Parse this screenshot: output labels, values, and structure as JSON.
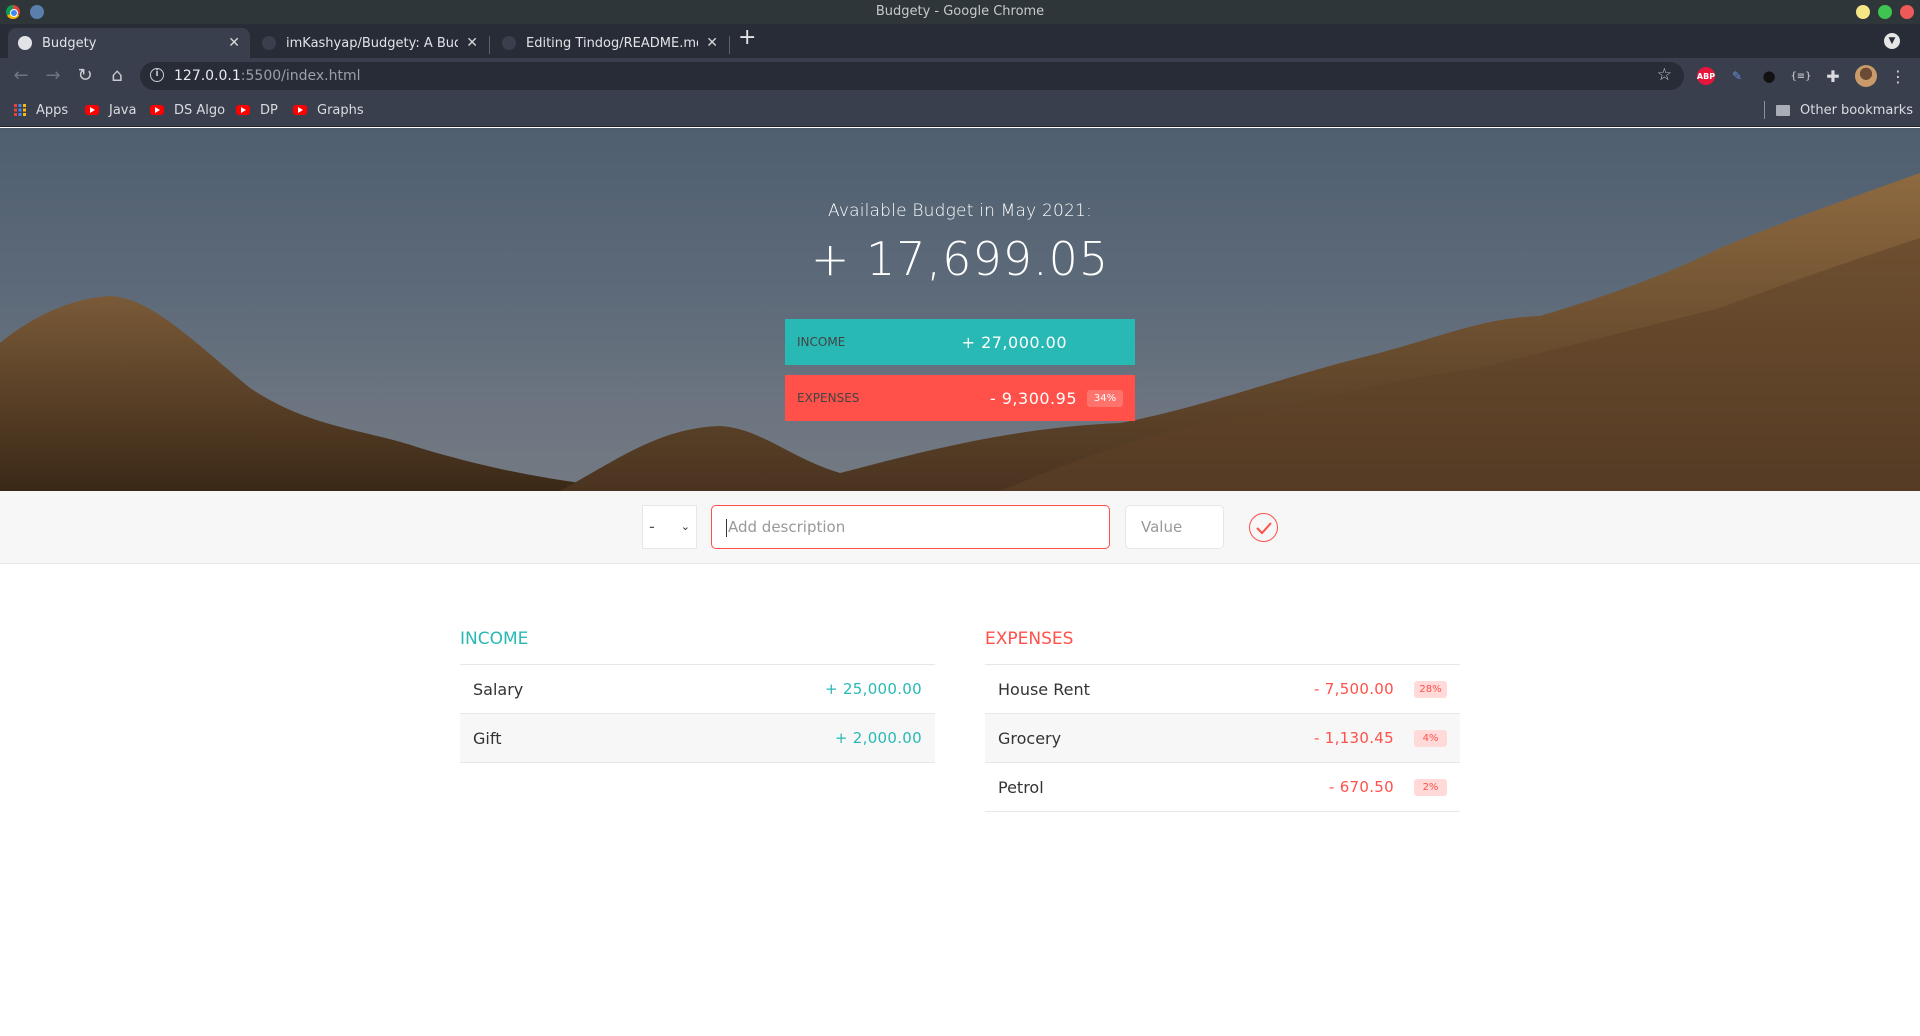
{
  "window": {
    "title": "Budgety - Google Chrome",
    "controls": {
      "minimize_color": "#f4e786",
      "maximize_color": "#3fc451",
      "close_color": "#ee5a5a"
    }
  },
  "tabs": [
    {
      "title": "Budgety",
      "favicon": "globe-icon",
      "active": true
    },
    {
      "title": "imKashyap/Budgety: A Budget",
      "favicon": "github-icon",
      "active": false
    },
    {
      "title": "Editing Tindog/README.md a",
      "favicon": "github-icon",
      "active": false
    }
  ],
  "toolbar": {
    "url_host": "127.0.0.1",
    "url_rest": ":5500/index.html",
    "extensions": [
      "adblock-plus-icon",
      "pen-icon",
      "footprint-icon",
      "json-viewer-icon",
      "extensions-puzzle-icon",
      "profile-avatar",
      "menu-kebab-icon"
    ],
    "abp_label": "ABP",
    "json_label": "{≡}"
  },
  "bookmarks": {
    "items": [
      {
        "label": "Apps",
        "icon": "apps-grid-icon"
      },
      {
        "label": "Java",
        "icon": "youtube-icon"
      },
      {
        "label": "DS Algo",
        "icon": "youtube-icon"
      },
      {
        "label": "DP",
        "icon": "youtube-icon"
      },
      {
        "label": "Graphs",
        "icon": "youtube-icon"
      }
    ],
    "other": "Other bookmarks"
  },
  "budget": {
    "title": "Available Budget in May 2021:",
    "value": "+ 17,699.05",
    "income_label": "Income",
    "income_value": "+ 27,000.00",
    "expenses_label": "Expenses",
    "expenses_value": "- 9,300.95",
    "expenses_percentage": "34%"
  },
  "add": {
    "type_selected": "-",
    "description_placeholder": "Add description",
    "value_placeholder": "Value"
  },
  "income": {
    "title": "Income",
    "items": [
      {
        "description": "Salary",
        "value": "+ 25,000.00"
      },
      {
        "description": "Gift",
        "value": "+ 2,000.00"
      }
    ]
  },
  "expenses": {
    "title": "Expenses",
    "items": [
      {
        "description": "House Rent",
        "value": "- 7,500.00",
        "percentage": "28%"
      },
      {
        "description": "Grocery",
        "value": "- 1,130.45",
        "percentage": "4%"
      },
      {
        "description": "Petrol",
        "value": "- 670.50",
        "percentage": "2%"
      }
    ]
  },
  "colors": {
    "income": "#28b9b5",
    "expense": "#ff5049"
  }
}
